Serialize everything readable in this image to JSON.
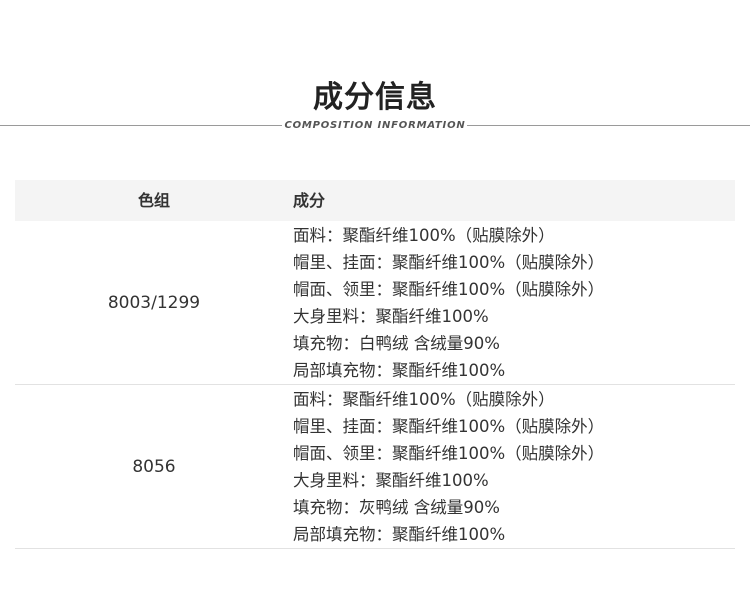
{
  "header": {
    "title": "成分信息",
    "subtitle": "COMPOSITION INFORMATION"
  },
  "table": {
    "headers": {
      "color_group": "色组",
      "composition": "成分"
    },
    "rows": [
      {
        "color": "8003/1299",
        "lines": [
          "面料：聚酯纤维100%（贴膜除外）",
          "帽里、挂面：聚酯纤维100%（贴膜除外）",
          "帽面、领里：聚酯纤维100%（贴膜除外）",
          "大身里料：聚酯纤维100%",
          "填充物：白鸭绒 含绒量90%",
          "局部填充物：聚酯纤维100%"
        ]
      },
      {
        "color": "8056",
        "lines": [
          "面料：聚酯纤维100%（贴膜除外）",
          "帽里、挂面：聚酯纤维100%（贴膜除外）",
          "帽面、领里：聚酯纤维100%（贴膜除外）",
          "大身里料：聚酯纤维100%",
          "填充物：灰鸭绒 含绒量90%",
          "局部填充物：聚酯纤维100%"
        ]
      }
    ]
  }
}
